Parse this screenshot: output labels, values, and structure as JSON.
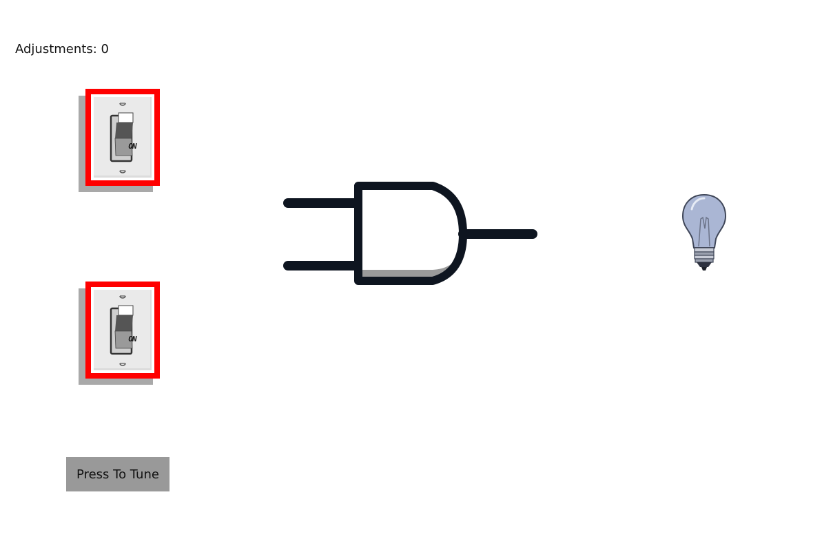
{
  "status": {
    "adjustments_label": "Adjustments: 0"
  },
  "switches": [
    {
      "label": "ON",
      "state": "on"
    },
    {
      "label": "ON",
      "state": "on"
    }
  ],
  "gate": {
    "type": "AND"
  },
  "output": {
    "lamp": "lightbulb-icon",
    "lit": false
  },
  "controls": {
    "tune_label": "Press To Tune"
  },
  "colors": {
    "switch_highlight": "#ff0000",
    "wire": "#0e1520",
    "button": "#999999",
    "bulb_glass": "#aab6d4"
  }
}
